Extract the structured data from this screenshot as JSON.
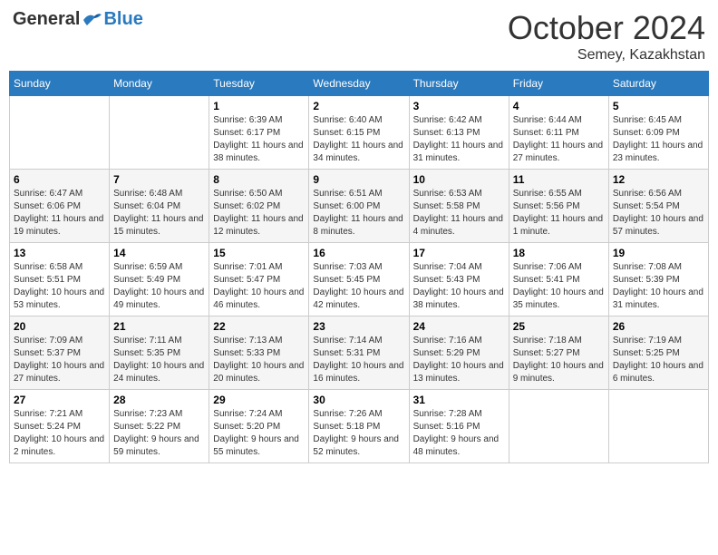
{
  "header": {
    "logo_general": "General",
    "logo_blue": "Blue",
    "month_title": "October 2024",
    "location": "Semey, Kazakhstan"
  },
  "weekdays": [
    "Sunday",
    "Monday",
    "Tuesday",
    "Wednesday",
    "Thursday",
    "Friday",
    "Saturday"
  ],
  "weeks": [
    [
      {
        "day": "",
        "info": ""
      },
      {
        "day": "",
        "info": ""
      },
      {
        "day": "1",
        "info": "Sunrise: 6:39 AM\nSunset: 6:17 PM\nDaylight: 11 hours and 38 minutes."
      },
      {
        "day": "2",
        "info": "Sunrise: 6:40 AM\nSunset: 6:15 PM\nDaylight: 11 hours and 34 minutes."
      },
      {
        "day": "3",
        "info": "Sunrise: 6:42 AM\nSunset: 6:13 PM\nDaylight: 11 hours and 31 minutes."
      },
      {
        "day": "4",
        "info": "Sunrise: 6:44 AM\nSunset: 6:11 PM\nDaylight: 11 hours and 27 minutes."
      },
      {
        "day": "5",
        "info": "Sunrise: 6:45 AM\nSunset: 6:09 PM\nDaylight: 11 hours and 23 minutes."
      }
    ],
    [
      {
        "day": "6",
        "info": "Sunrise: 6:47 AM\nSunset: 6:06 PM\nDaylight: 11 hours and 19 minutes."
      },
      {
        "day": "7",
        "info": "Sunrise: 6:48 AM\nSunset: 6:04 PM\nDaylight: 11 hours and 15 minutes."
      },
      {
        "day": "8",
        "info": "Sunrise: 6:50 AM\nSunset: 6:02 PM\nDaylight: 11 hours and 12 minutes."
      },
      {
        "day": "9",
        "info": "Sunrise: 6:51 AM\nSunset: 6:00 PM\nDaylight: 11 hours and 8 minutes."
      },
      {
        "day": "10",
        "info": "Sunrise: 6:53 AM\nSunset: 5:58 PM\nDaylight: 11 hours and 4 minutes."
      },
      {
        "day": "11",
        "info": "Sunrise: 6:55 AM\nSunset: 5:56 PM\nDaylight: 11 hours and 1 minute."
      },
      {
        "day": "12",
        "info": "Sunrise: 6:56 AM\nSunset: 5:54 PM\nDaylight: 10 hours and 57 minutes."
      }
    ],
    [
      {
        "day": "13",
        "info": "Sunrise: 6:58 AM\nSunset: 5:51 PM\nDaylight: 10 hours and 53 minutes."
      },
      {
        "day": "14",
        "info": "Sunrise: 6:59 AM\nSunset: 5:49 PM\nDaylight: 10 hours and 49 minutes."
      },
      {
        "day": "15",
        "info": "Sunrise: 7:01 AM\nSunset: 5:47 PM\nDaylight: 10 hours and 46 minutes."
      },
      {
        "day": "16",
        "info": "Sunrise: 7:03 AM\nSunset: 5:45 PM\nDaylight: 10 hours and 42 minutes."
      },
      {
        "day": "17",
        "info": "Sunrise: 7:04 AM\nSunset: 5:43 PM\nDaylight: 10 hours and 38 minutes."
      },
      {
        "day": "18",
        "info": "Sunrise: 7:06 AM\nSunset: 5:41 PM\nDaylight: 10 hours and 35 minutes."
      },
      {
        "day": "19",
        "info": "Sunrise: 7:08 AM\nSunset: 5:39 PM\nDaylight: 10 hours and 31 minutes."
      }
    ],
    [
      {
        "day": "20",
        "info": "Sunrise: 7:09 AM\nSunset: 5:37 PM\nDaylight: 10 hours and 27 minutes."
      },
      {
        "day": "21",
        "info": "Sunrise: 7:11 AM\nSunset: 5:35 PM\nDaylight: 10 hours and 24 minutes."
      },
      {
        "day": "22",
        "info": "Sunrise: 7:13 AM\nSunset: 5:33 PM\nDaylight: 10 hours and 20 minutes."
      },
      {
        "day": "23",
        "info": "Sunrise: 7:14 AM\nSunset: 5:31 PM\nDaylight: 10 hours and 16 minutes."
      },
      {
        "day": "24",
        "info": "Sunrise: 7:16 AM\nSunset: 5:29 PM\nDaylight: 10 hours and 13 minutes."
      },
      {
        "day": "25",
        "info": "Sunrise: 7:18 AM\nSunset: 5:27 PM\nDaylight: 10 hours and 9 minutes."
      },
      {
        "day": "26",
        "info": "Sunrise: 7:19 AM\nSunset: 5:25 PM\nDaylight: 10 hours and 6 minutes."
      }
    ],
    [
      {
        "day": "27",
        "info": "Sunrise: 7:21 AM\nSunset: 5:24 PM\nDaylight: 10 hours and 2 minutes."
      },
      {
        "day": "28",
        "info": "Sunrise: 7:23 AM\nSunset: 5:22 PM\nDaylight: 9 hours and 59 minutes."
      },
      {
        "day": "29",
        "info": "Sunrise: 7:24 AM\nSunset: 5:20 PM\nDaylight: 9 hours and 55 minutes."
      },
      {
        "day": "30",
        "info": "Sunrise: 7:26 AM\nSunset: 5:18 PM\nDaylight: 9 hours and 52 minutes."
      },
      {
        "day": "31",
        "info": "Sunrise: 7:28 AM\nSunset: 5:16 PM\nDaylight: 9 hours and 48 minutes."
      },
      {
        "day": "",
        "info": ""
      },
      {
        "day": "",
        "info": ""
      }
    ]
  ]
}
